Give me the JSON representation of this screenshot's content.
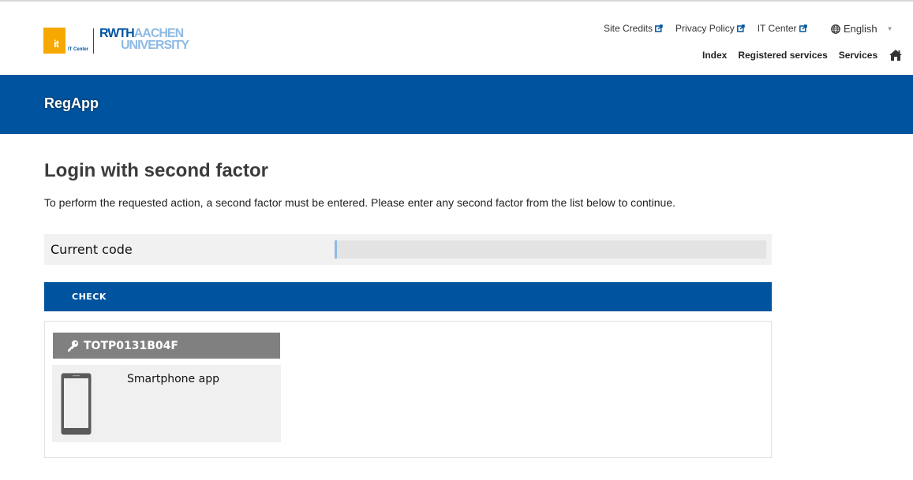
{
  "header": {
    "logo": {
      "it_mark": "it",
      "it_center": "IT Center",
      "rwth": "RWTH",
      "aachen": "AACHEN",
      "university": "UNIVERSITY"
    },
    "top_links": [
      {
        "label": "Site Credits",
        "icon": "external-link-icon"
      },
      {
        "label": "Privacy Policy",
        "icon": "external-link-icon"
      },
      {
        "label": "IT Center",
        "icon": "external-link-icon"
      }
    ],
    "language": {
      "icon": "globe-icon",
      "selected": "English"
    },
    "nav": [
      {
        "label": "Index"
      },
      {
        "label": "Registered services"
      },
      {
        "label": "Services"
      }
    ],
    "home_icon": "home-icon"
  },
  "banner": {
    "title": "RegApp"
  },
  "main": {
    "title": "Login with second factor",
    "intro": "To perform the requested action, a second factor must be entered. Please enter any second factor from the list below to continue.",
    "code_field": {
      "label": "Current code",
      "value": "",
      "placeholder": ""
    },
    "check_button": "CHECK",
    "tokens": [
      {
        "icon": "key-icon",
        "id": "TOTP0131B04F",
        "device_icon": "smartphone-icon",
        "type": "Smartphone app"
      }
    ]
  },
  "colors": {
    "primary": "#00549f",
    "accent_orange": "#f6a800",
    "light_blue": "#8ebae5",
    "token_header": "#808080"
  }
}
